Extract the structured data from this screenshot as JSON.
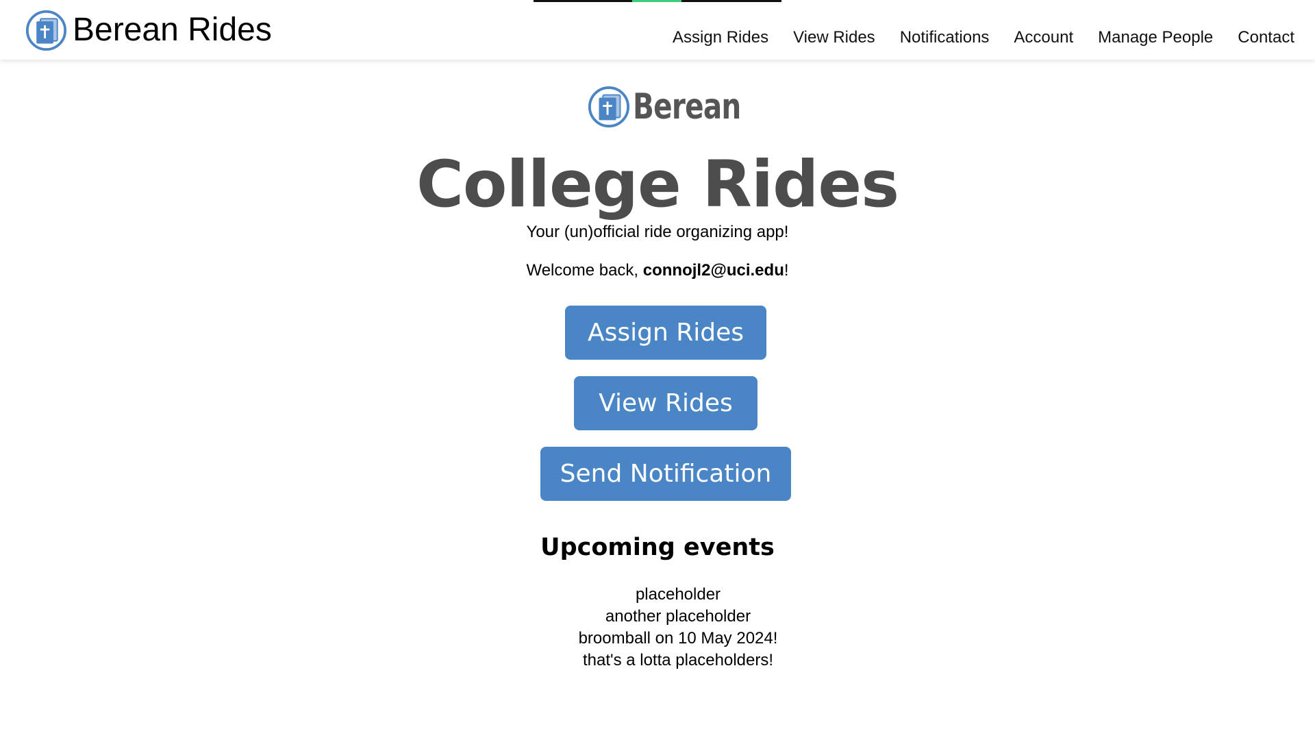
{
  "brand": {
    "name": "Berean Rides",
    "logo_icon": "bible-cross-icon",
    "accent_color": "#4a85c6"
  },
  "nav": {
    "items": [
      {
        "label": "Assign Rides"
      },
      {
        "label": "View Rides"
      },
      {
        "label": "Notifications"
      },
      {
        "label": "Account"
      },
      {
        "label": "Manage People"
      },
      {
        "label": "Contact"
      }
    ]
  },
  "hero": {
    "logo_text": "Berean",
    "title": "College Rides",
    "tagline": "Your (un)official ride organizing app!",
    "welcome_prefix": "Welcome back, ",
    "user_email": "connojl2@uci.edu",
    "welcome_suffix": "!"
  },
  "actions": {
    "assign_label": "Assign Rides",
    "view_label": "View Rides",
    "notify_label": "Send Notification",
    "button_color": "#4a85c6"
  },
  "events": {
    "heading": "Upcoming events",
    "items": [
      "placeholder",
      "another placeholder",
      "broomball on 10 May 2024!",
      "that's a lotta placeholders!"
    ]
  }
}
